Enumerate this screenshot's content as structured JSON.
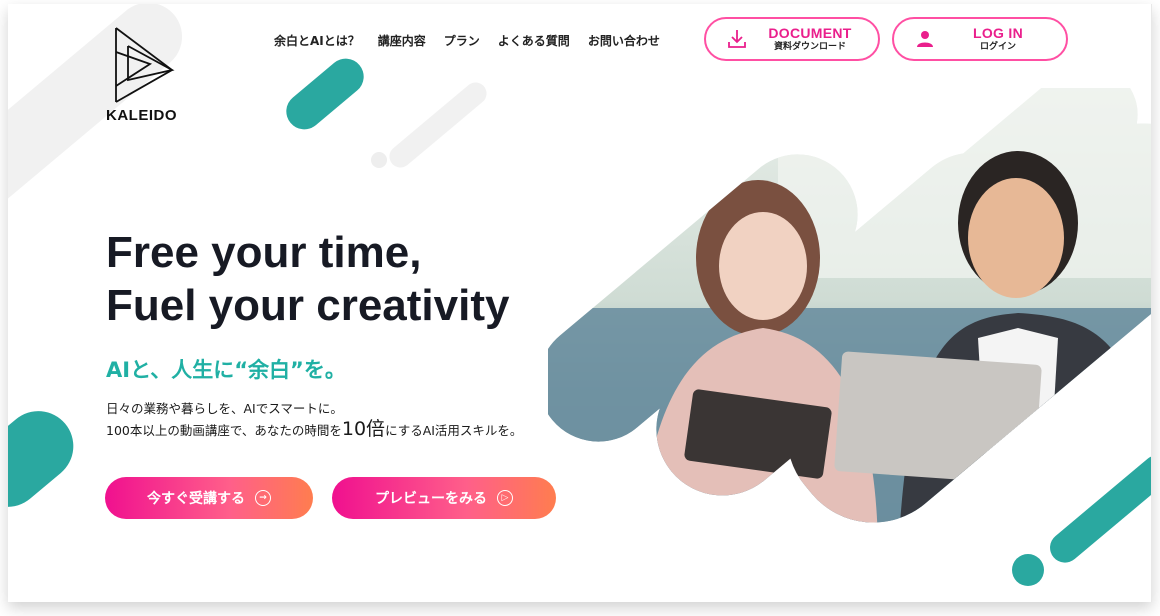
{
  "brand": {
    "name": "KALEIDO"
  },
  "nav": {
    "items": [
      "余白とAIとは？",
      "講座内容",
      "プラン",
      "よくある質問",
      "お問い合わせ"
    ],
    "document_button": {
      "main": "DOCUMENT",
      "sub": "資料ダウンロード"
    },
    "login_button": {
      "main": "LOG IN",
      "sub": "ログイン"
    }
  },
  "hero": {
    "headline_line1": "Free your time,",
    "headline_line2": "Fuel your creativity",
    "tagline": "AIと、人生に“余白”を。",
    "desc_line1": "日々の業務や暮らしを、AIでスマートに。",
    "desc_line2_pre": "100本以上の動画講座で、あなたの時間を",
    "desc_line2_big": "10倍",
    "desc_line2_post": "にするAI活用スキルを。",
    "cta_primary": "今すぐ受講する",
    "cta_secondary": "プレビューをみる"
  },
  "colors": {
    "accent_pink": "#ea1f8c",
    "accent_teal": "#2aa8a0",
    "gradient_end": "#ff7d4f"
  },
  "icons": {
    "document": "download-icon",
    "login": "user-icon",
    "cta_primary": "arrow-circle-icon",
    "cta_secondary": "play-circle-icon"
  }
}
